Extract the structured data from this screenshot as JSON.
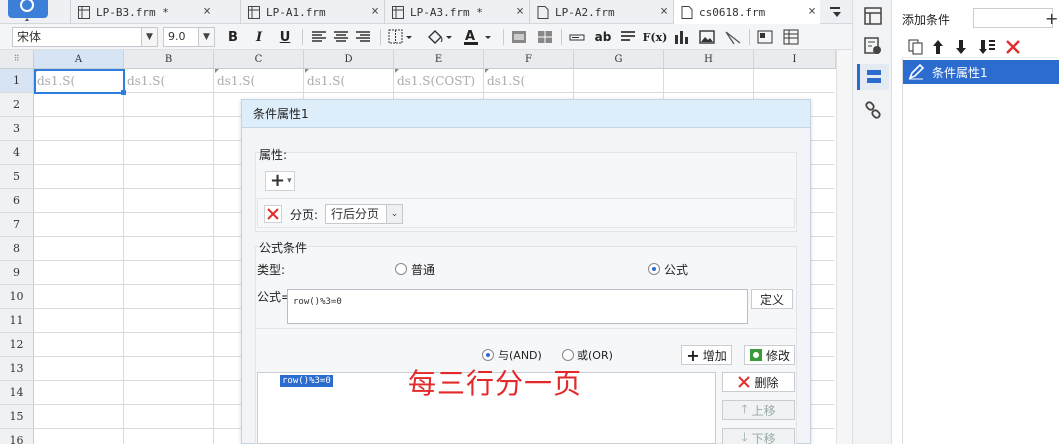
{
  "tabs": [
    {
      "label": "LP-B3.frm *",
      "close": "×"
    },
    {
      "label": "LP-A1.frm",
      "close": "×"
    },
    {
      "label": "LP-A3.frm *",
      "close": "×"
    },
    {
      "label": "LP-A2.frm",
      "close": "×"
    },
    {
      "label": "cs0618.frm",
      "close": "×",
      "active": true
    }
  ],
  "toolbar": {
    "font_family": "宋体",
    "font_size": "9.0",
    "bold": "B",
    "italic": "I",
    "underline": "U",
    "abc": "ab",
    "fx": "F(x)"
  },
  "grid": {
    "corner": "⠿",
    "columns": [
      "A",
      "B",
      "C",
      "D",
      "E",
      "F",
      "G",
      "H",
      "I"
    ],
    "rows": [
      "1",
      "2",
      "3",
      "4",
      "5",
      "6",
      "7",
      "8",
      "9",
      "10",
      "11",
      "12",
      "13",
      "14",
      "15",
      "16"
    ],
    "row1_cells": [
      "ds1.S(",
      "ds1.S(",
      "ds1.S(",
      "ds1.S(",
      "ds1.S(COST)",
      "ds1.S("
    ]
  },
  "dialog": {
    "title": "条件属性1",
    "properties_label": "属性:",
    "add_symbol": "+",
    "add_caret": "▾",
    "paging_label": "分页:",
    "paging_value": "行后分页",
    "formula_section": "公式条件",
    "type_label": "类型:",
    "type_normal": "普通",
    "type_formula": "公式",
    "type_selected": "formula",
    "formula_label": "公式=",
    "formula_value": "row()%3=0",
    "define_btn": "定义",
    "and_label": "与(AND)",
    "or_label": "或(OR)",
    "logic_selected": "and",
    "add_btn": "增加",
    "modify_btn": "修改",
    "delete_btn": "删除",
    "up_btn": "上移",
    "down_btn": "下移",
    "condition_item": "row()%3=0"
  },
  "annotation": "每三行分一页",
  "right_panel": {
    "add_condition_label": "添加条件",
    "add_plus": "+",
    "selected_item": "条件属性1"
  },
  "colors": {
    "accent": "#2d6ccf",
    "annotation": "#e32a2a",
    "delete": "#e02d2d"
  }
}
